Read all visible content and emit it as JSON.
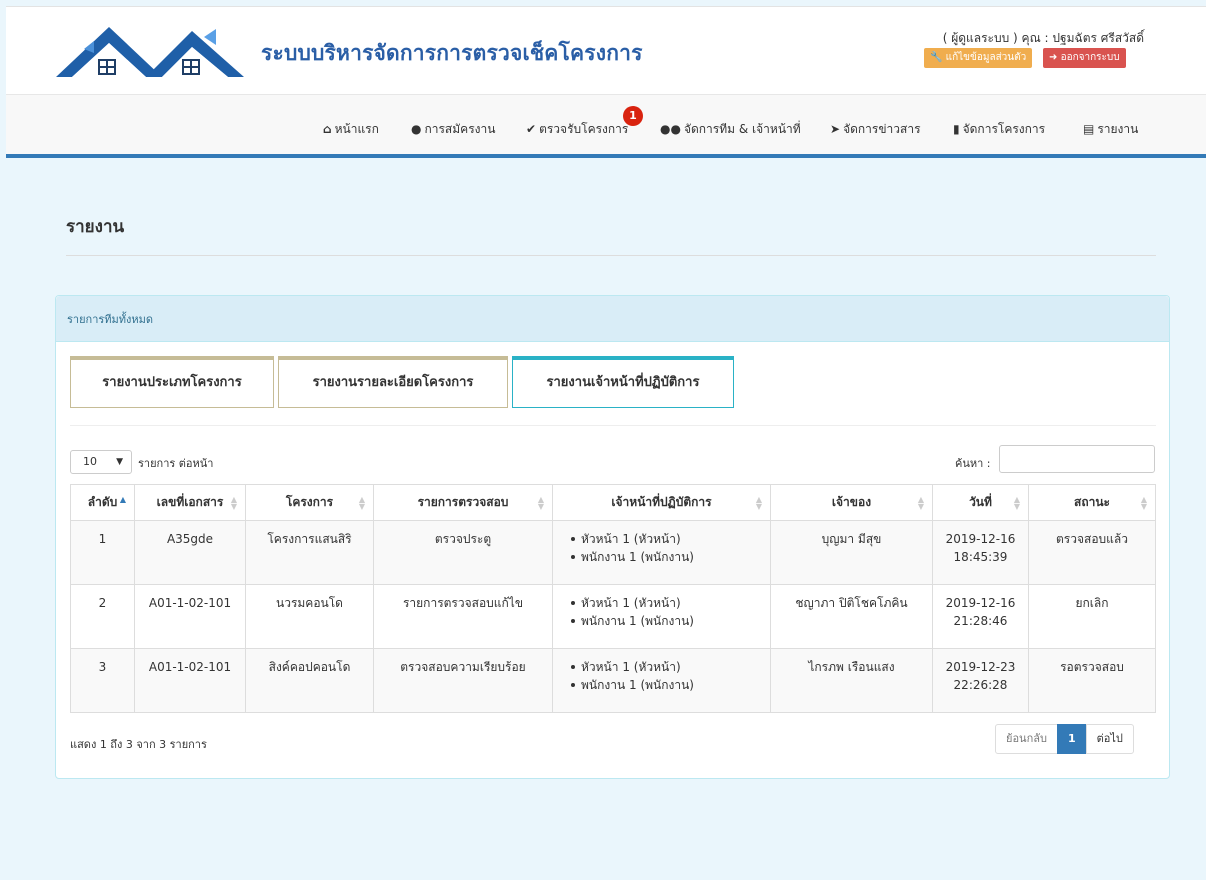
{
  "header": {
    "site_title": "ระบบบริหารจัดการการตรวจเช็คโครงการ",
    "user_line": "( ผู้ดูแลระบบ ) คุณ : ปฐมฉัตร ศรีสวัสดิ์",
    "edit_profile": "แก้ไขข้อมูลส่วนตัว",
    "logout": "ออกจากระบบ"
  },
  "nav": {
    "home": "หน้าแรก",
    "apply": "การสมัครงาน",
    "check": "ตรวจรับโครงการ",
    "check_badge": "1",
    "team": "จัดการทีม & เจ้าหน้าที่",
    "news": "จัดการข่าวสาร",
    "project": "จัดการโครงการ",
    "report": "รายงาน"
  },
  "page": {
    "title": "รายงาน"
  },
  "panel": {
    "heading": "รายการทีมทั้งหมด",
    "tabs": [
      {
        "label": "รายงานประเภทโครงการ"
      },
      {
        "label": "รายงานรายละเอียดโครงการ"
      },
      {
        "label": "รายงานเจ้าหน้าที่ปฏิบัติการ"
      }
    ],
    "active_tab": 2,
    "page_length": "10",
    "length_label": "รายการ ต่อหน้า",
    "search_label": "ค้นหา :"
  },
  "table": {
    "headers": [
      "ลำดับ",
      "เลขที่เอกสาร",
      "โครงการ",
      "รายการตรวจสอบ",
      "เจ้าหน้าที่ปฏิบัติการ",
      "เจ้าของ",
      "วันที่",
      "สถานะ"
    ],
    "rows": [
      {
        "no": "1",
        "doc": "A35gde",
        "project": "โครงการแสนสิริ",
        "item": "ตรวจประตู",
        "staff": [
          "หัวหน้า 1 (หัวหน้า)",
          "พนักงาน 1 (พนักงาน)"
        ],
        "owner": "บุญมา มีสุข",
        "date": "2019-12-16",
        "time": "18:45:39",
        "status": "ตรวจสอบแล้ว"
      },
      {
        "no": "2",
        "doc": "A01-1-02-101",
        "project": "นวรมคอนโด",
        "item": "รายการตรวจสอบแก้ไข",
        "staff": [
          "หัวหน้า 1 (หัวหน้า)",
          "พนักงาน 1 (พนักงาน)"
        ],
        "owner": "ชญาภา ปิติโชคโภคิน",
        "date": "2019-12-16",
        "time": "21:28:46",
        "status": "ยกเลิก"
      },
      {
        "no": "3",
        "doc": "A01-1-02-101",
        "project": "สิงค์คอปคอนโด",
        "item": "ตรวจสอบความเรียบร้อย",
        "staff": [
          "หัวหน้า 1 (หัวหน้า)",
          "พนักงาน 1 (พนักงาน)"
        ],
        "owner": "ไกรภพ เรือนแสง",
        "date": "2019-12-23",
        "time": "22:26:28",
        "status": "รอตรวจสอบ"
      }
    ]
  },
  "footer": {
    "info": "แสดง 1 ถึง 3 จาก 3 รายการ",
    "prev": "ย้อนกลับ",
    "page": "1",
    "next": "ต่อไป"
  }
}
